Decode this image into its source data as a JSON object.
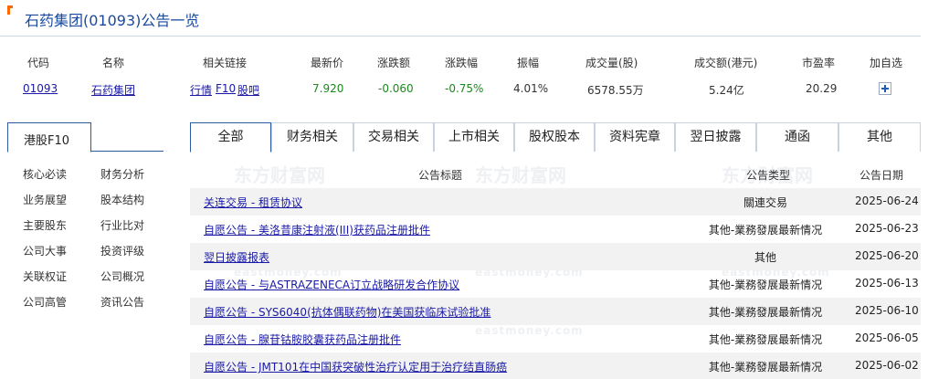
{
  "title": "石药集团(01093)公告一览",
  "quote": {
    "headers": [
      "代码",
      "名称",
      "相关链接",
      "最新价",
      "涨跌额",
      "涨跌幅",
      "振幅",
      "成交量(股)",
      "成交额(港元)",
      "市盈率",
      "加自选"
    ],
    "code": "01093",
    "name": "石药集团",
    "links": [
      "行情",
      "F10",
      "股吧"
    ],
    "price": "7.920",
    "change": "-0.060",
    "change_pct": "-0.75%",
    "amplitude": "4.01%",
    "volume": "6578.55万",
    "turnover": "5.24亿",
    "pe": "20.29",
    "add_icon": "plus-icon"
  },
  "sidebar": {
    "tab": "港股F10",
    "links": [
      "核心必读",
      "财务分析",
      "业务展望",
      "股本结构",
      "主要股东",
      "行业比对",
      "公司大事",
      "投资评级",
      "关联权证",
      "公司概况",
      "公司高管",
      "资讯公告"
    ]
  },
  "tabs": [
    "全部",
    "财务相关",
    "交易相关",
    "上市相关",
    "股权股本",
    "资料宪章",
    "翌日披露",
    "通函",
    "其他"
  ],
  "table": {
    "headers": [
      "公告标题",
      "公告类型",
      "公告日期"
    ],
    "rows": [
      {
        "title": "关连交易 - 租赁协议",
        "type": "關連交易",
        "date": "2025-06-24"
      },
      {
        "title": "自愿公告 - 美洛昔康注射液(III)获药品注册批件",
        "type": "其他-業務發展最新情况",
        "date": "2025-06-23"
      },
      {
        "title": "翌日披露报表",
        "type": "其他",
        "date": "2025-06-20"
      },
      {
        "title": "自愿公告 - 与ASTRAZENECA订立战略研发合作协议",
        "type": "其他-業務發展最新情况",
        "date": "2025-06-13"
      },
      {
        "title": "自愿公告 - SYS6040(抗体偶联药物)在美国获临床试验批准",
        "type": "其他-業務發展最新情况",
        "date": "2025-06-10"
      },
      {
        "title": "自愿公告 - 腺苷钴胺胶囊获药品注册批件",
        "type": "其他-業務發展最新情况",
        "date": "2025-06-05"
      },
      {
        "title": "自愿公告 - JMT101在中国获突破性治疗认定用于治疗结直肠癌",
        "type": "其他-業務發展最新情况",
        "date": "2025-06-02"
      }
    ]
  },
  "watermark": {
    "cn": "东方财富网",
    "en": "eastmoney.com"
  }
}
